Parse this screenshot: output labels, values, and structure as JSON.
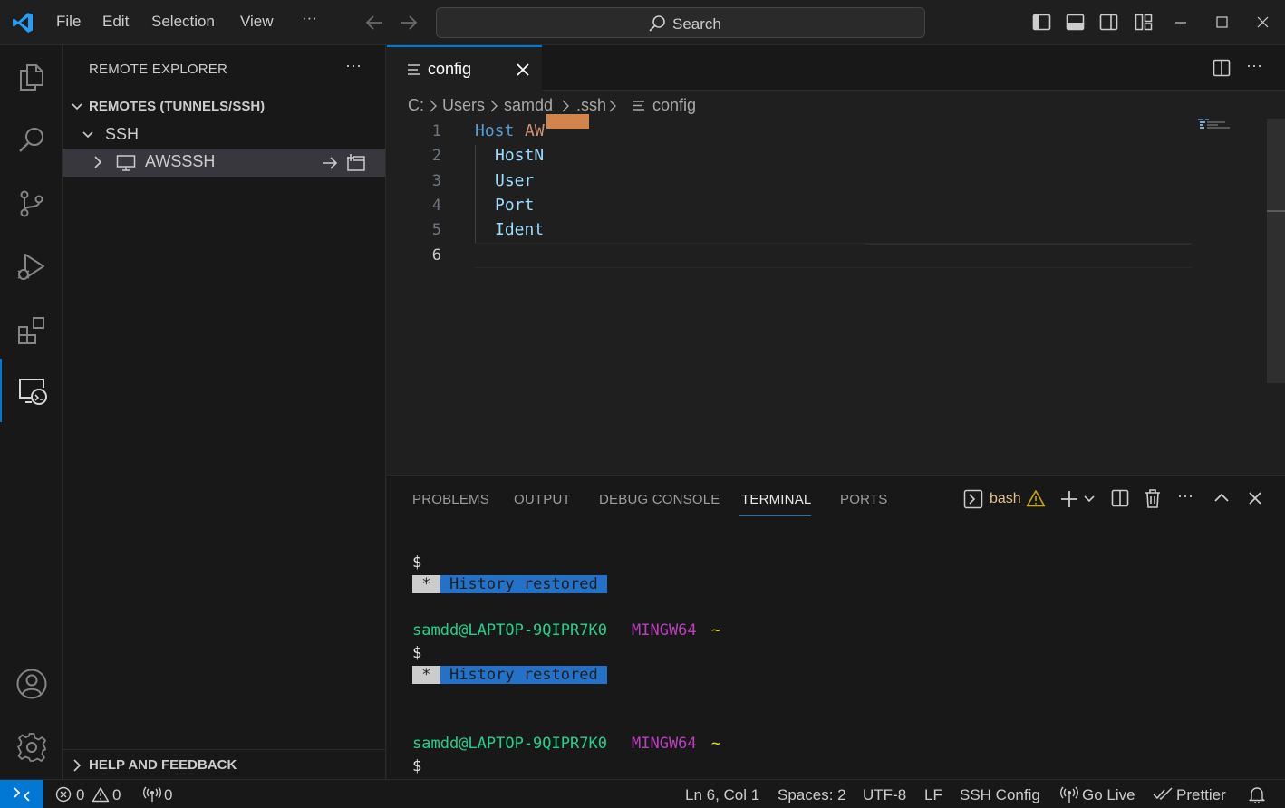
{
  "menu": {
    "file": "File",
    "edit": "Edit",
    "selection": "Selection",
    "view": "View",
    "more": "···"
  },
  "search": {
    "label": "Search"
  },
  "sidebar": {
    "title": "REMOTE EXPLORER",
    "more": "···",
    "section": "REMOTES (TUNNELS/SSH)",
    "group": "SSH",
    "host": "AWSSSH",
    "help": "HELP AND FEEDBACK"
  },
  "editor": {
    "tab_label": "config",
    "breadcrumb": [
      "C:",
      "Users",
      "samdd",
      ".ssh",
      "config"
    ],
    "lines": [
      {
        "n": "1",
        "key": "Host",
        "val": "AW"
      },
      {
        "n": "2",
        "key": "HostN",
        "val": ""
      },
      {
        "n": "3",
        "key": "User",
        "val": ""
      },
      {
        "n": "4",
        "key": "Port",
        "val": ""
      },
      {
        "n": "5",
        "key": "Ident",
        "val": ""
      },
      {
        "n": "6",
        "key": "",
        "val": ""
      }
    ]
  },
  "panel": {
    "tabs": [
      "PROBLEMS",
      "OUTPUT",
      "DEBUG CONSOLE",
      "TERMINAL",
      "PORTS"
    ],
    "active_tab": "TERMINAL",
    "shell": "bash",
    "terminal": {
      "prompt_symbol": "$",
      "history_star": " * ",
      "history_text": " History restored ",
      "user_host": "samdd@LAPTOP-9QIPR7K0",
      "env": "MINGW64",
      "dir": "~"
    }
  },
  "status": {
    "errors": "0",
    "warnings": "0",
    "ports": "0",
    "position": "Ln 6, Col 1",
    "spaces": "Spaces: 2",
    "encoding": "UTF-8",
    "eol": "LF",
    "language": "SSH Config",
    "golive": "Go Live",
    "prettier": "Prettier"
  },
  "colors": {
    "accent": "#0078d4",
    "terminal_green": "#23d18b",
    "terminal_magenta": "#bc3fbc",
    "terminal_yellow": "#e5e510"
  }
}
